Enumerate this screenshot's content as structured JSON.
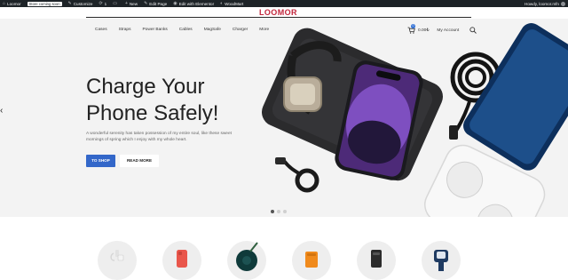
{
  "admin_bar": {
    "site_name": "Loomor",
    "coming_soon_badge": "Store coming soon",
    "customize": "Customize",
    "updates_count": "1",
    "new": "New",
    "edit_page": "Edit Page",
    "edit_elementor": "Edit with Elementor",
    "woodmart": "WoodMart",
    "greeting": "Howdy, loomor.mfn"
  },
  "header": {
    "logo": "LOOMOR",
    "nav": [
      "Cases",
      "Straps",
      "Power Banks",
      "Cables",
      "MagSafe",
      "Charger",
      "More"
    ],
    "cart_count": "0",
    "cart_total": "0.00₺",
    "account": "My Account"
  },
  "hero": {
    "title_line1": "Charge Your",
    "title_line2": "Phone Safely!",
    "subtitle": "A wonderful serenity has taken possession of my entire soul, like these sweet mornings of spring which I enjoy with my whole heart.",
    "primary_button": "TO SHOP",
    "secondary_button": "READ MORE",
    "active_slide": 1,
    "slide_count": 3
  },
  "categories": [
    {
      "icon": "cable-icon"
    },
    {
      "icon": "phone-case-icon"
    },
    {
      "icon": "magsafe-icon"
    },
    {
      "icon": "power-bank-icon"
    },
    {
      "icon": "battery-pack-icon"
    },
    {
      "icon": "watch-strap-icon"
    }
  ],
  "colors": {
    "admin_bar": "#1d2327",
    "logo": "#c2263c",
    "primary": "#3367c9",
    "hero_bg": "#f3f3f3"
  }
}
